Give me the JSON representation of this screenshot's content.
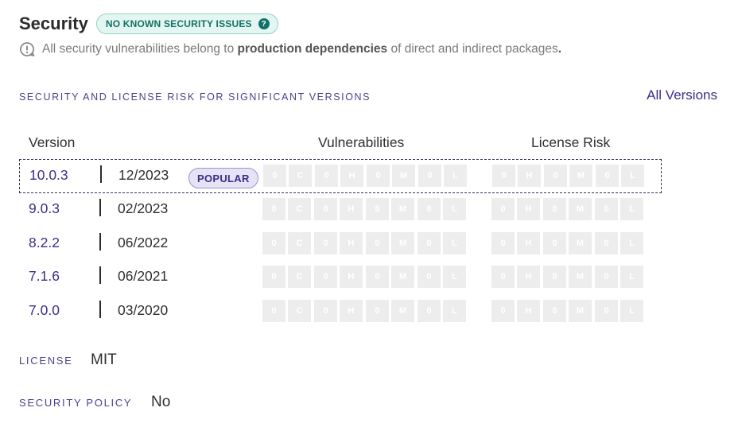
{
  "header": {
    "title": "Security",
    "badge": "NO KNOWN SECURITY ISSUES",
    "badge_help_icon": "?",
    "subtitle_pre": "All security vulnerabilities belong to ",
    "subtitle_bold": "production dependencies",
    "subtitle_post": " of direct and indirect packages",
    "subtitle_dot": "."
  },
  "risk": {
    "heading": "SECURITY AND LICENSE RISK FOR SIGNIFICANT VERSIONS",
    "all_versions": "All Versions",
    "columns": {
      "version": "Version",
      "vulnerabilities": "Vulnerabilities",
      "license": "License Risk"
    },
    "separator": "|",
    "popular_label": "POPULAR",
    "vuln_letters": [
      "C",
      "H",
      "M",
      "L"
    ],
    "license_letters": [
      "H",
      "M",
      "L"
    ],
    "rows": [
      {
        "version": "10.0.3",
        "date": "12/2023",
        "popular": true,
        "vulns": [
          0,
          0,
          0,
          0
        ],
        "license": [
          0,
          0,
          0
        ]
      },
      {
        "version": "9.0.3",
        "date": "02/2023",
        "popular": false,
        "vulns": [
          0,
          0,
          0,
          0
        ],
        "license": [
          0,
          0,
          0
        ]
      },
      {
        "version": "8.2.2",
        "date": "06/2022",
        "popular": false,
        "vulns": [
          0,
          0,
          0,
          0
        ],
        "license": [
          0,
          0,
          0
        ]
      },
      {
        "version": "7.1.6",
        "date": "06/2021",
        "popular": false,
        "vulns": [
          0,
          0,
          0,
          0
        ],
        "license": [
          0,
          0,
          0
        ]
      },
      {
        "version": "7.0.0",
        "date": "03/2020",
        "popular": false,
        "vulns": [
          0,
          0,
          0,
          0
        ],
        "license": [
          0,
          0,
          0
        ]
      }
    ]
  },
  "meta": {
    "license_label": "LICENSE",
    "license_value": "MIT",
    "policy_label": "SECURITY POLICY",
    "policy_value": "No"
  },
  "colors": {
    "accent": "#3d2d8a",
    "badge_text": "#137166",
    "badge_bg": "#e4f6f2",
    "cell_bg": "#ededed"
  },
  "icons": {
    "help": "question-circle-icon",
    "subtitle": "speech-bubble-alert-icon"
  }
}
